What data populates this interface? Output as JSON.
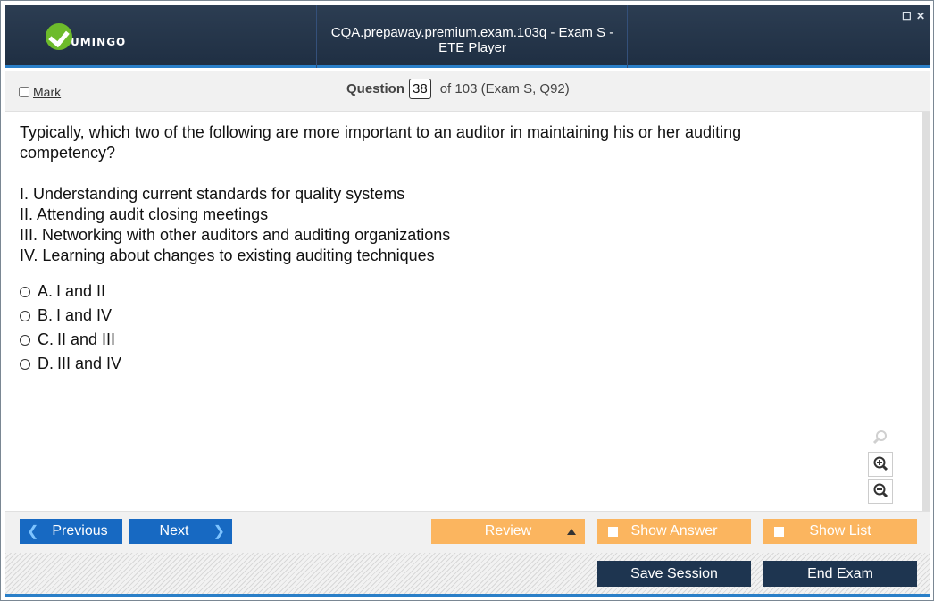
{
  "app": {
    "logo_text": "UMINGO",
    "window_title": "CQA.prepaway.premium.exam.103q - Exam S - ETE Player",
    "controls": {
      "minimize": "_",
      "maximize": "☐",
      "close": "✕"
    }
  },
  "question_bar": {
    "mark_label": "Mark",
    "question_label": "Question",
    "question_number": "38",
    "of_text": "of 103 (Exam S, Q92)"
  },
  "question": {
    "text": "Typically, which two of the following are more important to an auditor in maintaining his or her auditing competency?",
    "statements": [
      "I. Understanding current standards for quality systems",
      "II. Attending audit closing meetings",
      "III. Networking with other auditors and auditing organizations",
      "IV. Learning about changes to existing auditing techniques"
    ],
    "options": [
      {
        "letter": "A.",
        "text": "I and II"
      },
      {
        "letter": "B.",
        "text": "I and IV"
      },
      {
        "letter": "C.",
        "text": "II and III"
      },
      {
        "letter": "D.",
        "text": "III and IV"
      }
    ]
  },
  "navigation": {
    "previous": "Previous",
    "next": "Next",
    "review": "Review",
    "show_answer": "Show Answer",
    "show_list": "Show List"
  },
  "footer": {
    "save_session": "Save Session",
    "end_exam": "End Exam"
  },
  "colors": {
    "titlebar": "#1f2f43",
    "accent_blue": "#1769c2",
    "orange": "#fbb55f",
    "dark_button": "#1e3550"
  }
}
